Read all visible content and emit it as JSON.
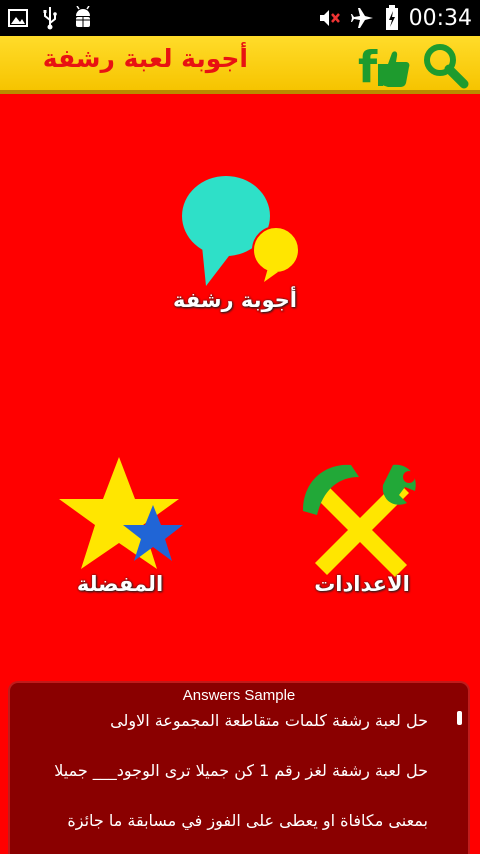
{
  "status_bar": {
    "time": "00:34",
    "icons": [
      "image-icon",
      "usb-icon",
      "android-debug-icon",
      "mute-icon",
      "airplane-icon",
      "battery-charging-icon"
    ]
  },
  "app_bar": {
    "title": "أجوبة لعبة رشفة",
    "facebook_like_label": "f",
    "search_icon": "search-icon"
  },
  "menu": {
    "answers_label": "أجوبة رشفة",
    "favorites_label": "المفضلة",
    "settings_label": "الاعدادات"
  },
  "answers_panel": {
    "title": "Answers Sample",
    "lines": [
      "حل لعبة رشفة كلمات متقاطعة المجموعة الاولى",
      "حل لعبة رشفة لغز رقم 1 كن جميلا ترى الوجود___ جميلا",
      "بمعنى مكافاة او يعطى على الفوز في مسابقة ما جائزة"
    ]
  },
  "colors": {
    "background": "#ff0000",
    "app_bar": "#ffd21a",
    "title_text": "#e81212",
    "panel": "#8a0000"
  }
}
